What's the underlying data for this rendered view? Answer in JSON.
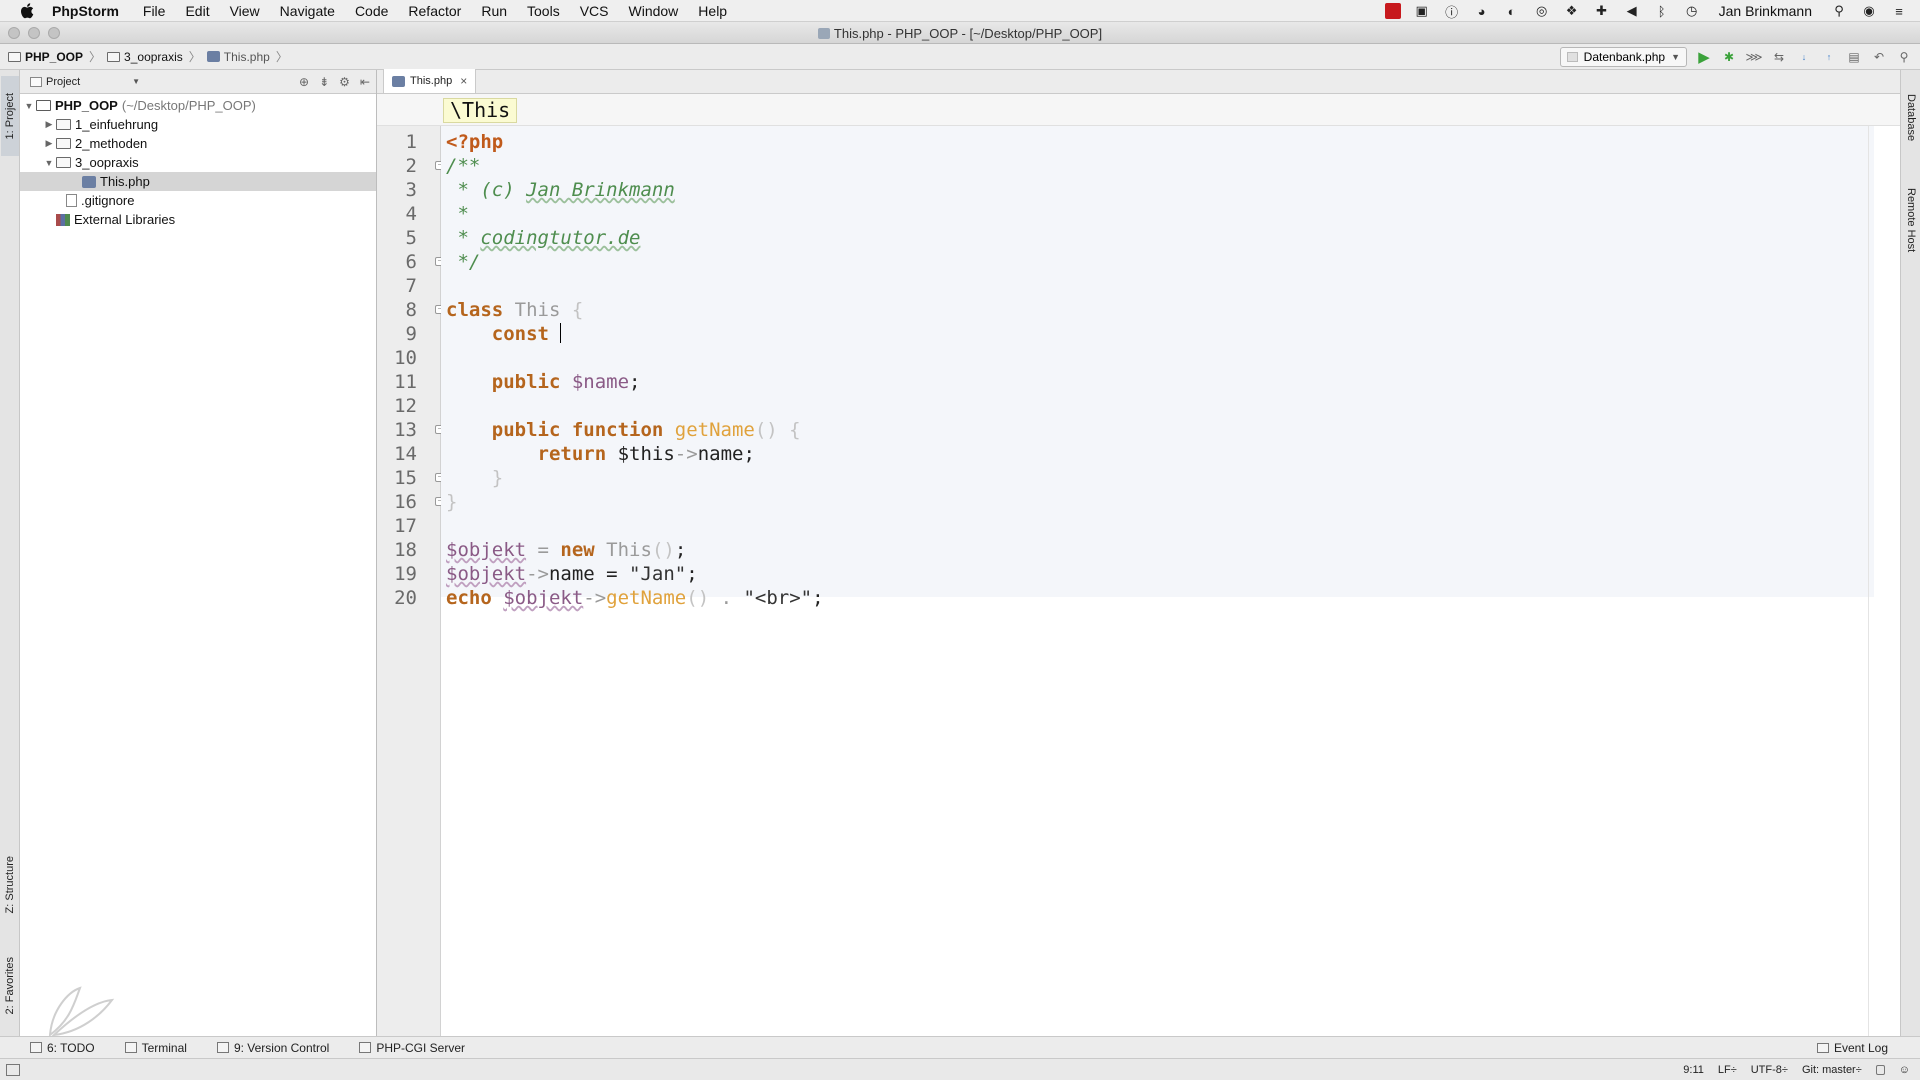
{
  "menubar": {
    "app_name": "PhpStorm",
    "items": [
      "File",
      "Edit",
      "View",
      "Navigate",
      "Code",
      "Refactor",
      "Run",
      "Tools",
      "VCS",
      "Window",
      "Help"
    ],
    "user": "Jan Brinkmann"
  },
  "window": {
    "title": "This.php - PHP_OOP - [~/Desktop/PHP_OOP]"
  },
  "navbar": {
    "breadcrumbs": [
      "PHP_OOP",
      "3_oopraxis",
      "This.php"
    ],
    "run_config": "Datenbank.php"
  },
  "left_tools": {
    "project_tab": "1: Project",
    "structure_tab": "Z: Structure",
    "favorites_tab": "2: Favorites"
  },
  "right_tools": {
    "database_tab": "Database",
    "remote_host_tab": "Remote Host"
  },
  "project_panel": {
    "view_mode": "Project",
    "tree": {
      "root_name": "PHP_OOP",
      "root_path": "(~/Desktop/PHP_OOP)",
      "folder1": "1_einfuehrung",
      "folder2": "2_methoden",
      "folder3": "3_oopraxis",
      "file_active": "This.php",
      "file_gitignore": ".gitignore",
      "external": "External Libraries"
    }
  },
  "editor": {
    "tab_label": "This.php",
    "context_label": "\\This",
    "line_numbers": [
      "1",
      "2",
      "3",
      "4",
      "5",
      "6",
      "7",
      "8",
      "9",
      "10",
      "11",
      "12",
      "13",
      "14",
      "15",
      "16",
      "17",
      "18",
      "19",
      "20"
    ]
  },
  "code": {
    "l1_open": "<?php",
    "l2": "/**",
    "l3a": " * (c) ",
    "l3b": "Jan Brinkmann",
    "l4": " *",
    "l5a": " * ",
    "l5b": "codingtutor.de",
    "l6": " */",
    "l8_kw": "class",
    "l8_name": " This ",
    "l8_brace": "{",
    "l9_kw": "    const ",
    "l11_kw": "    public ",
    "l11_var": "$name",
    "l11_semi": ";",
    "l13_kw": "    public function ",
    "l13_fn": "getName",
    "l13_rest": "() {",
    "l14_kw": "        return ",
    "l14_var": "$this",
    "l14_arrow": "->",
    "l14_prop": "name;",
    "l15": "    }",
    "l16": "}",
    "l18_var": "$objekt",
    "l18_eq": " = ",
    "l18_kw": "new",
    "l18_cls": " This",
    "l18_paren": "()",
    "l18_semi": ";",
    "l19_var": "$objekt",
    "l19_arrow": "->",
    "l19_prop": "name = ",
    "l19_str": "\"Jan\"",
    "l19_semi": ";",
    "l20_kw": "echo ",
    "l20_var": "$objekt",
    "l20_arrow": "->",
    "l20_fn": "getName",
    "l20_paren": "()",
    "l20_dot": " . ",
    "l20_str": "\"<br>\"",
    "l20_semi": ";"
  },
  "bottom_tools": {
    "todo": "6: TODO",
    "terminal": "Terminal",
    "version_control": "9: Version Control",
    "php_cgi": "PHP-CGI Server",
    "event_log": "Event Log"
  },
  "statusbar": {
    "position": "9:11",
    "line_sep": "LF÷",
    "encoding": "UTF-8÷",
    "git": "Git: master÷"
  }
}
